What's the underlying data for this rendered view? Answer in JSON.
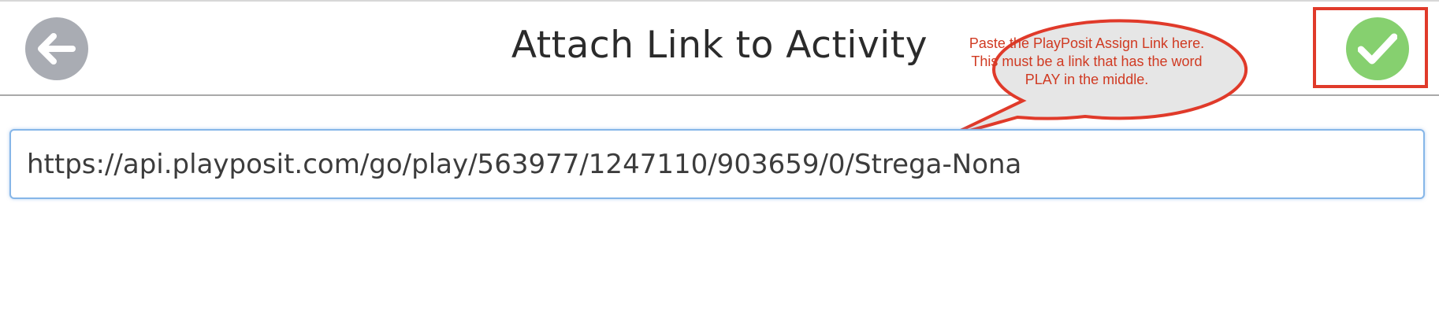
{
  "header": {
    "title": "Attach Link to Activity",
    "back_icon": "arrow-left-icon",
    "confirm_icon": "checkmark-icon"
  },
  "link_field": {
    "value": "https://api.playposit.com/go/play/563977/1247110/903659/0/Strega-Nona"
  },
  "annotation": {
    "text": "Paste the PlayPosit Assign Link here. This must be a link that has the word PLAY in the middle."
  },
  "colors": {
    "back_button": "#a9acb3",
    "confirm_button": "#86d06f",
    "annotation_red": "#e03a2a",
    "callout_fill": "#e6e6e6",
    "field_focus_border": "#86b6e8"
  }
}
